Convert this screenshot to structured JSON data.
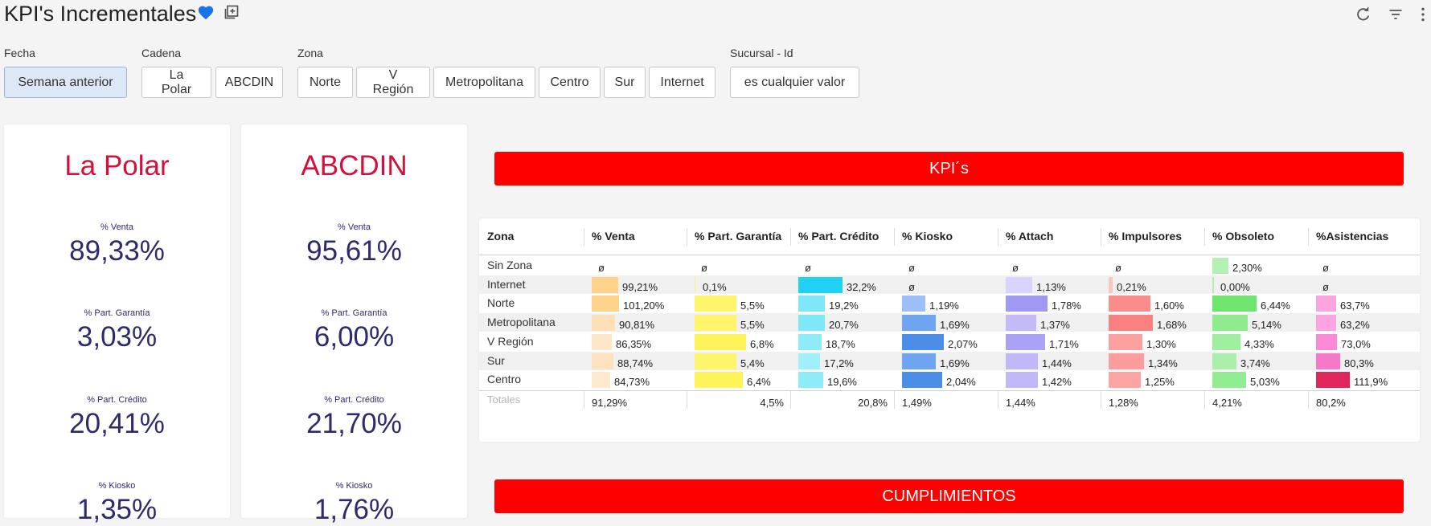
{
  "header": {
    "title": "KPI's Incrementales",
    "icons": [
      "heart-icon",
      "add-to-dashboard-icon",
      "refresh-icon",
      "filter-icon",
      "more-vert-icon"
    ],
    "heart_color": "#1a73e8"
  },
  "filters": [
    {
      "label": "Fecha",
      "options": [
        "Semana anterior"
      ],
      "active": 0
    },
    {
      "label": "Cadena",
      "options": [
        "La Polar",
        "ABCDIN"
      ]
    },
    {
      "label": "Zona",
      "options": [
        "Norte",
        "V Región",
        "Metropolitana",
        "Centro",
        "Sur",
        "Internet"
      ]
    },
    {
      "label": "Sucursal - Id",
      "options": [
        "es cualquier valor"
      ]
    }
  ],
  "cards": [
    {
      "name": "La Polar",
      "metrics": [
        {
          "label": "% Venta",
          "value": "89,33%"
        },
        {
          "label": "% Part. Garantía",
          "value": "3,03%"
        },
        {
          "label": "% Part. Crédito",
          "value": "20,41%"
        },
        {
          "label": "% Kiosko",
          "value": "1,35%"
        }
      ]
    },
    {
      "name": "ABCDIN",
      "metrics": [
        {
          "label": "% Venta",
          "value": "95,61%"
        },
        {
          "label": "% Part. Garantía",
          "value": "6,00%"
        },
        {
          "label": "% Part. Crédito",
          "value": "21,70%"
        },
        {
          "label": "% Kiosko",
          "value": "1,76%"
        }
      ]
    }
  ],
  "banners": {
    "kpis": "KPI´s",
    "cumplimientos": "CUMPLIMIENTOS"
  },
  "colors": {
    "banner": "#ff0000",
    "card_title": "#d4103d",
    "metric": "#2e2a6e"
  },
  "table": {
    "columns": [
      "Zona",
      "% Venta",
      "% Part. Garantía",
      "% Part. Crédito",
      "% Kiosko",
      "% Attach",
      "% Impulsores",
      "% Obsoleto",
      "%Asistencias"
    ],
    "rows": [
      {
        "zona": "Sin Zona",
        "cells": [
          {
            "text": "ø",
            "fraction": 0,
            "color": ""
          },
          {
            "text": "ø",
            "fraction": 0,
            "color": ""
          },
          {
            "text": "ø",
            "fraction": 0,
            "color": ""
          },
          {
            "text": "ø",
            "fraction": 0,
            "color": ""
          },
          {
            "text": "ø",
            "fraction": 0,
            "color": ""
          },
          {
            "text": "ø",
            "fraction": 0,
            "color": ""
          },
          {
            "text": "2,30%",
            "fraction": 0.2,
            "color": "#b3f0b3"
          },
          {
            "text": "ø",
            "fraction": 0,
            "color": ""
          }
        ]
      },
      {
        "zona": "Internet",
        "cells": [
          {
            "text": "99,21%",
            "fraction": 0.33,
            "color": "#fdd28a"
          },
          {
            "text": "0,1%",
            "fraction": 0.01,
            "color": "#fff27a"
          },
          {
            "text": "32,2%",
            "fraction": 0.55,
            "color": "#1fd1f2"
          },
          {
            "text": "ø",
            "fraction": 0,
            "color": ""
          },
          {
            "text": "1,13%",
            "fraction": 0.33,
            "color": "#d9d4fb"
          },
          {
            "text": "0,21%",
            "fraction": 0.05,
            "color": "#fbc4bc"
          },
          {
            "text": "0,00%",
            "fraction": 0.02,
            "color": "#b3f0b3"
          },
          {
            "text": "ø",
            "fraction": 0,
            "color": ""
          }
        ]
      },
      {
        "zona": "Norte",
        "cells": [
          {
            "text": "101,20%",
            "fraction": 0.34,
            "color": "#fdd28a"
          },
          {
            "text": "5,5%",
            "fraction": 0.52,
            "color": "#fff56a"
          },
          {
            "text": "19,2%",
            "fraction": 0.33,
            "color": "#7fe8f8"
          },
          {
            "text": "1,19%",
            "fraction": 0.29,
            "color": "#9cbff7"
          },
          {
            "text": "1,78%",
            "fraction": 0.52,
            "color": "#a099f4"
          },
          {
            "text": "1,60%",
            "fraction": 0.52,
            "color": "#fb8c8c"
          },
          {
            "text": "6,44%",
            "fraction": 0.55,
            "color": "#6ee66e"
          },
          {
            "text": "63,7%",
            "fraction": 0.25,
            "color": "#fba4e0"
          }
        ]
      },
      {
        "zona": "Metropolitana",
        "cells": [
          {
            "text": "90,81%",
            "fraction": 0.29,
            "color": "#fde0b5"
          },
          {
            "text": "5,5%",
            "fraction": 0.52,
            "color": "#fff56a"
          },
          {
            "text": "20,7%",
            "fraction": 0.33,
            "color": "#7fe8f8"
          },
          {
            "text": "1,69%",
            "fraction": 0.42,
            "color": "#6fa4f0"
          },
          {
            "text": "1,37%",
            "fraction": 0.38,
            "color": "#c3bbf8"
          },
          {
            "text": "1,68%",
            "fraction": 0.55,
            "color": "#fb8080"
          },
          {
            "text": "5,14%",
            "fraction": 0.44,
            "color": "#8eeb8e"
          },
          {
            "text": "63,2%",
            "fraction": 0.25,
            "color": "#fba4e0"
          }
        ]
      },
      {
        "zona": "V Región",
        "cells": [
          {
            "text": "86,35%",
            "fraction": 0.25,
            "color": "#fee7c8"
          },
          {
            "text": "6,8%",
            "fraction": 0.64,
            "color": "#fff35a"
          },
          {
            "text": "18,7%",
            "fraction": 0.29,
            "color": "#8eecf9"
          },
          {
            "text": "2,07%",
            "fraction": 0.52,
            "color": "#4a8ee8"
          },
          {
            "text": "1,71%",
            "fraction": 0.49,
            "color": "#aaa2f5"
          },
          {
            "text": "1,30%",
            "fraction": 0.42,
            "color": "#fca0a0"
          },
          {
            "text": "4,33%",
            "fraction": 0.35,
            "color": "#a0eea0"
          },
          {
            "text": "73,0%",
            "fraction": 0.26,
            "color": "#f88ad6"
          }
        ]
      },
      {
        "zona": "Sur",
        "cells": [
          {
            "text": "88,74%",
            "fraction": 0.27,
            "color": "#fee2bd"
          },
          {
            "text": "5,4%",
            "fraction": 0.52,
            "color": "#fff56a"
          },
          {
            "text": "17,2%",
            "fraction": 0.27,
            "color": "#a0effa"
          },
          {
            "text": "1,69%",
            "fraction": 0.42,
            "color": "#6fa4f0"
          },
          {
            "text": "1,44%",
            "fraction": 0.4,
            "color": "#c0b8f7"
          },
          {
            "text": "1,34%",
            "fraction": 0.44,
            "color": "#fc9c9c"
          },
          {
            "text": "3,74%",
            "fraction": 0.3,
            "color": "#aaf0aa"
          },
          {
            "text": "80,3%",
            "fraction": 0.3,
            "color": "#f47ac9"
          }
        ]
      },
      {
        "zona": "Centro",
        "cells": [
          {
            "text": "84,73%",
            "fraction": 0.23,
            "color": "#feeacf"
          },
          {
            "text": "6,4%",
            "fraction": 0.6,
            "color": "#fff35a"
          },
          {
            "text": "19,6%",
            "fraction": 0.31,
            "color": "#8eecf9"
          },
          {
            "text": "2,04%",
            "fraction": 0.5,
            "color": "#4a8ee8"
          },
          {
            "text": "1,42%",
            "fraction": 0.4,
            "color": "#c0b8f7"
          },
          {
            "text": "1,25%",
            "fraction": 0.4,
            "color": "#fca4a4"
          },
          {
            "text": "5,03%",
            "fraction": 0.42,
            "color": "#92ec92"
          },
          {
            "text": "111,9%",
            "fraction": 0.42,
            "color": "#e0265a"
          }
        ]
      }
    ],
    "totals": {
      "label": "Totales",
      "values": [
        "91,29%",
        "4,5%",
        "20,8%",
        "1,49%",
        "1,44%",
        "1,28%",
        "4,21%",
        "80,2%"
      ]
    }
  }
}
